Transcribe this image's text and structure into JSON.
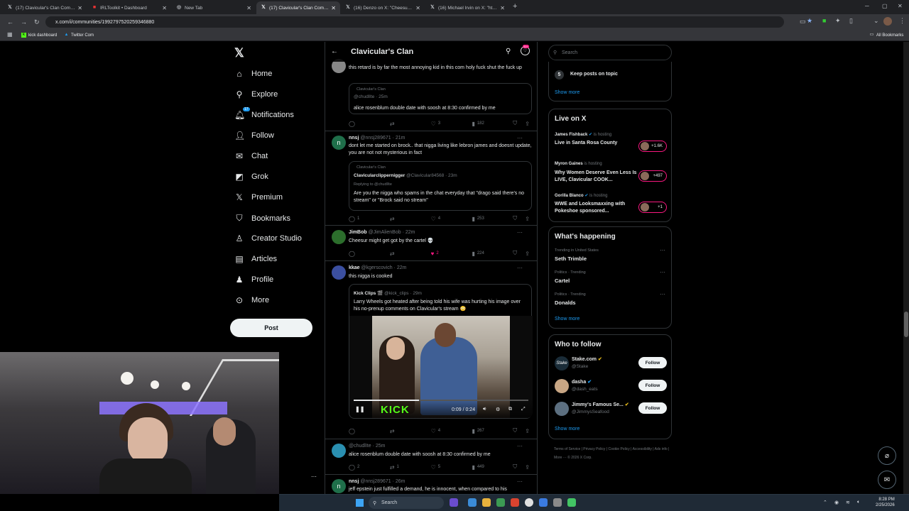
{
  "browser": {
    "tabs": [
      {
        "title": "(17) Clavicular's Clan Communi",
        "active": false
      },
      {
        "title": "IRLToolkit • Dashboard",
        "active": false
      },
      {
        "title": "New Tab",
        "active": false
      },
      {
        "title": "(17) Clavicular's Clan Communi",
        "active": true
      },
      {
        "title": "(16) Denzo on X: \"Cheesur DE...",
        "active": false
      },
      {
        "title": "(16) Michael Irvin on X: \"https:",
        "active": false
      }
    ],
    "url": "x.com/i/communities/1992797520259346880",
    "bookmarks": [
      "kick dashboard",
      "Twitter Com"
    ],
    "all_bookmarks": "All Bookmarks"
  },
  "leftnav": {
    "items": [
      {
        "label": "Home",
        "icon": "home-icon"
      },
      {
        "label": "Explore",
        "icon": "search-icon"
      },
      {
        "label": "Notifications",
        "icon": "bell-icon",
        "badge": "17"
      },
      {
        "label": "Follow",
        "icon": "follow-icon"
      },
      {
        "label": "Chat",
        "icon": "mail-icon"
      },
      {
        "label": "Grok",
        "icon": "grok-icon"
      },
      {
        "label": "Premium",
        "icon": "x-premium-icon"
      },
      {
        "label": "Bookmarks",
        "icon": "bookmark-icon"
      },
      {
        "label": "Creator Studio",
        "icon": "creator-icon"
      },
      {
        "label": "Articles",
        "icon": "articles-icon"
      },
      {
        "label": "Profile",
        "icon": "person-icon"
      },
      {
        "label": "More",
        "icon": "more-circle-icon"
      }
    ],
    "post_label": "Post"
  },
  "feed": {
    "title": "Clavicular's Clan",
    "notif_count": "20+",
    "tweets": [
      {
        "text": "this retard is by far the most annoying kid in this com holy fuck shut the fuck up",
        "quote": {
          "community": "Clavicular's Clan",
          "handle": "@chudlIte · 25m",
          "text": "alice rosenblum double date with soosh at 8:30 confirmed by me"
        },
        "actions": {
          "replies": "",
          "reposts": "",
          "likes": "3",
          "views": "182"
        }
      },
      {
        "name": "nnsj",
        "handle": "@nnsj289671 · 21m",
        "text": "dont let me started on brock.. that nigga living like lebron james and doesnt update, you are not not mysterious in fact",
        "quote": {
          "community": "Clavicular's Clan",
          "name": "Clavicularclippernigger",
          "handle": "@Clavicular84568 · 23m",
          "replying": "Replying to @chudlIte",
          "text": "Are you the nigga who spams in the chat everyday that \"drago said there's no stream\" or \"Brock said no stream\""
        },
        "actions": {
          "replies": "1",
          "reposts": "",
          "likes": "4",
          "views": "253"
        }
      },
      {
        "name": "JimBob",
        "handle": "@JimAlienBob · 22m",
        "text": "Cheesur might get got by the cartel 💀",
        "actions": {
          "replies": "",
          "reposts": "",
          "likes": "2",
          "views": "224"
        }
      },
      {
        "name": "kkae",
        "handle": "@kgerscovich · 22m",
        "text": "this nigga is cooked",
        "quote": {
          "name": "Kick Clips 🎬",
          "handle": "@kick_clips · 29m",
          "text": "Larry Wheels got heated after being told his wife was hurting his image over his no-prenup comments on Clavicular's stream 😳"
        },
        "video": {
          "time": "0:09 / 0:24",
          "brand": "KICK",
          "progress": 0.375
        },
        "actions": {
          "replies": "",
          "reposts": "",
          "likes": "4",
          "views": "267"
        }
      },
      {
        "handle": "@chudlIte · 25m",
        "text": "alice rosenblum double date with soosh at 8:30 confirmed by me",
        "actions": {
          "replies": "2",
          "reposts": "1",
          "likes": "5",
          "views": "449"
        }
      },
      {
        "name": "nnsj",
        "handle": "@nnsj289671 · 26m",
        "text": "jeff epstein just fulfilled a demand, he is innocent, when compared to his"
      }
    ]
  },
  "right": {
    "search_placeholder": "Search",
    "rules": {
      "num": "5",
      "label": "Keep posts on topic",
      "show_more": "Show more"
    },
    "live": {
      "title": "Live on X",
      "items": [
        {
          "host": "James Fishback",
          "status": "is hosting",
          "title": "Live in Santa Rosa County",
          "count": "+1.6K"
        },
        {
          "host": "Myron Gaines",
          "status": "is hosting",
          "title": "Why Women Deserve Even Less Is LIVE, Clavicular COOK...",
          "count": "+497"
        },
        {
          "host": "Gorilla Blanco",
          "status": "is hosting",
          "title": "WWE and Looksmaxxing with Pokeshoe sponsored...",
          "count": "+1"
        }
      ]
    },
    "happening": {
      "title": "What's happening",
      "trends": [
        {
          "category": "Trending in United States",
          "name": "Seth Trimble"
        },
        {
          "category": "Politics · Trending",
          "name": "Cartel"
        },
        {
          "category": "Politics · Trending",
          "name": "Donalds"
        }
      ],
      "show_more": "Show more"
    },
    "who_to_follow": {
      "title": "Who to follow",
      "users": [
        {
          "name": "Stake.com",
          "handle": "@Stake",
          "button": "Follow"
        },
        {
          "name": "dasha",
          "handle": "@dash_eats",
          "button": "Follow"
        },
        {
          "name": "Jimmy's Famous Se...",
          "handle": "@JimmysSeafood",
          "button": "Follow"
        }
      ],
      "show_more": "Show more"
    },
    "footer": "Terms of Service  |  Privacy Policy  |  Cookie Policy  |  Accessibility  |  Ads info  |  More ···  © 2026 X Corp."
  },
  "taskbar": {
    "search": "Search",
    "time": "8:28 PM",
    "date": "2/25/2026"
  },
  "colors": {
    "accent": "#1d9bf0",
    "like_pink": "#f91880",
    "kick_green": "#53fc18"
  }
}
